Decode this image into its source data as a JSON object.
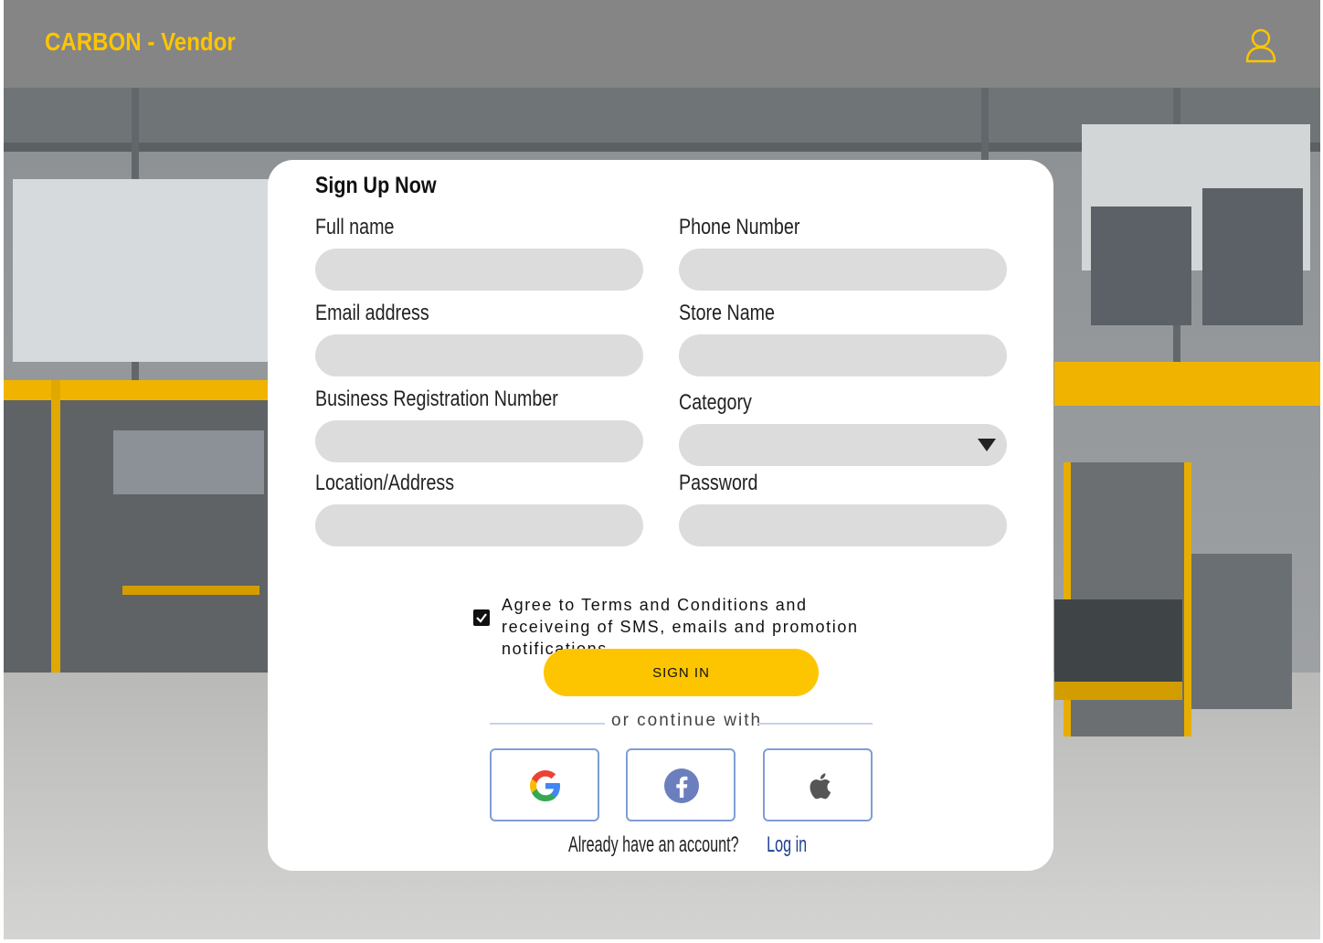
{
  "app": {
    "title": "CARBON - Vendor",
    "brand_color": "#fdc500"
  },
  "header": {
    "user_icon": "user-icon"
  },
  "form": {
    "title": "Sign Up Now",
    "fields": {
      "full_name": {
        "label": "Full name",
        "value": ""
      },
      "phone_number": {
        "label": "Phone Number",
        "value": ""
      },
      "email": {
        "label": "Email address",
        "value": ""
      },
      "store_name": {
        "label": "Store Name",
        "value": ""
      },
      "business_reg": {
        "label": "Business Registration Number",
        "value": ""
      },
      "category": {
        "label": "Category",
        "value": ""
      },
      "location": {
        "label": "Location/Address",
        "value": ""
      },
      "password": {
        "label": "Password",
        "value": ""
      }
    },
    "terms": {
      "checked": true,
      "text": "Agree to Terms and Conditions and receiveing of SMS, emails and promotion notifications."
    },
    "submit_label": "SIGN  IN",
    "divider_text": "or continue with",
    "social": [
      "google-icon",
      "facebook-icon",
      "apple-icon"
    ],
    "footer": {
      "prompt": "Already have an account?",
      "link": "Log in"
    }
  }
}
